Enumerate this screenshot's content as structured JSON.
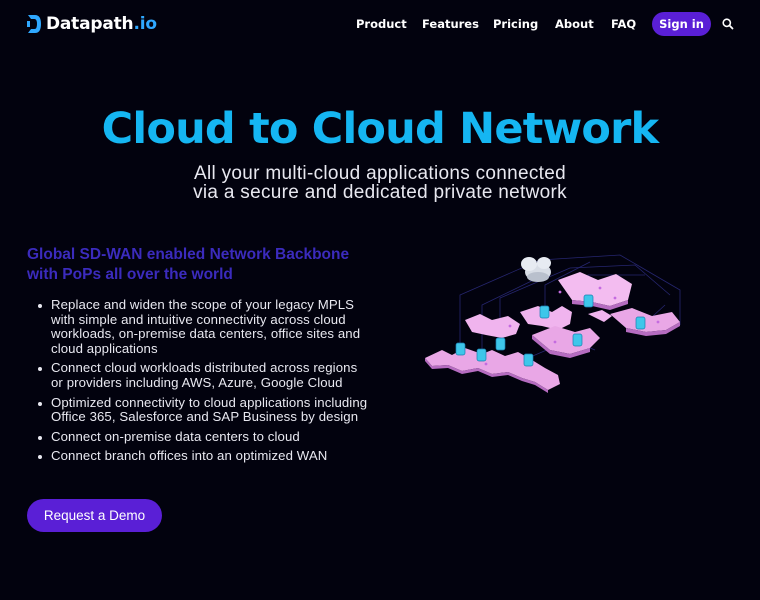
{
  "header": {
    "logo_text": "Datapath",
    "logo_tld": ".io",
    "nav": [
      {
        "label": "Product"
      },
      {
        "label": "Features"
      },
      {
        "label": "Pricing"
      },
      {
        "label": "About"
      },
      {
        "label": "FAQ"
      }
    ],
    "signin_label": "Sign in",
    "search_icon": "search-icon"
  },
  "hero": {
    "title": "Cloud to Cloud Network",
    "subtitle_line1": "All your multi-cloud applications connected",
    "subtitle_line2": "via a secure and dedicated private network"
  },
  "features": {
    "title": "Global SD-WAN enabled Network Backbone with PoPs all over the world",
    "items": [
      "Replace and widen the scope of your legacy MPLS with simple and intuitive connectivity across cloud workloads, on-premise data centers, office sites and cloud applications",
      "Connect cloud workloads distributed across regions or providers including AWS, Azure, Google Cloud",
      "Optimized connectivity to cloud applications including Office 365, Salesforce and SAP Business by design",
      "Connect on-premise data centers to cloud",
      "Connect branch offices into an optimized WAN"
    ]
  },
  "cta": {
    "demo_label": "Request a Demo"
  },
  "illustration": {
    "icon": "world-map-network-illustration"
  },
  "colors": {
    "background": "#02020e",
    "accent": "#5a1fd6",
    "title": "#15b6f2",
    "feature_title": "#3b2bbd",
    "map_pink": "#f0a8e8",
    "server_cyan": "#3ec6ea"
  }
}
